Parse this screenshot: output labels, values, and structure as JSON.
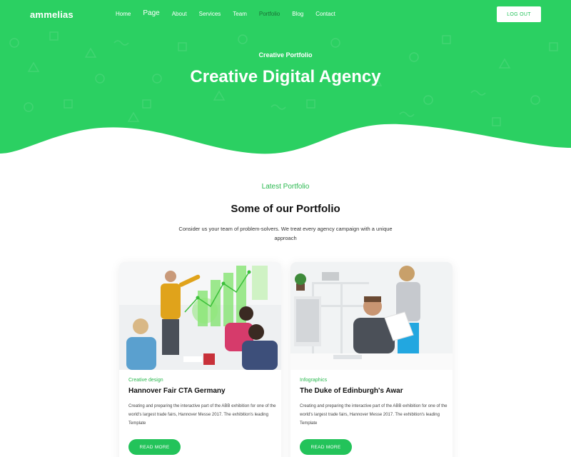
{
  "brand": {
    "name": "ammelias"
  },
  "nav": {
    "items": [
      {
        "label": "Home"
      },
      {
        "label": "Page"
      },
      {
        "label": "About"
      },
      {
        "label": "Services"
      },
      {
        "label": "Team"
      },
      {
        "label": "Portfolio"
      },
      {
        "label": "Blog"
      },
      {
        "label": "Contact"
      }
    ],
    "active": "Portfolio",
    "logout_label": "LOG OUT"
  },
  "hero": {
    "subtitle": "Creative Portfolio",
    "title": "Creative Digital Agency"
  },
  "section": {
    "eyebrow": "Latest Portfolio",
    "title": "Some of our Portfolio",
    "description": "Consider us your team of problem-solvers. We treat every agency campaign with a unique approach"
  },
  "cards": [
    {
      "category": "Creative design",
      "title": "Hannover Fair CTA Germany",
      "text": "Creating and preparing the interactive part of the ABB exhibition for one of the world's largest trade fairs, Hannover Messe 2017. The exhibition's leading Template",
      "button": "READ MORE"
    },
    {
      "category": "Infographics",
      "title": "The Duke of Edinburgh's Awar",
      "text": "Creating and preparing the interactive part of the ABB exhibition for one of the world's largest trade fairs, Hannover Messe 2017. The exhibition's leading Template",
      "button": "READ MORE"
    }
  ],
  "colors": {
    "primary": "#23c35a",
    "primary_dark": "#1b6e35",
    "accent_text": "#2ab84f"
  }
}
